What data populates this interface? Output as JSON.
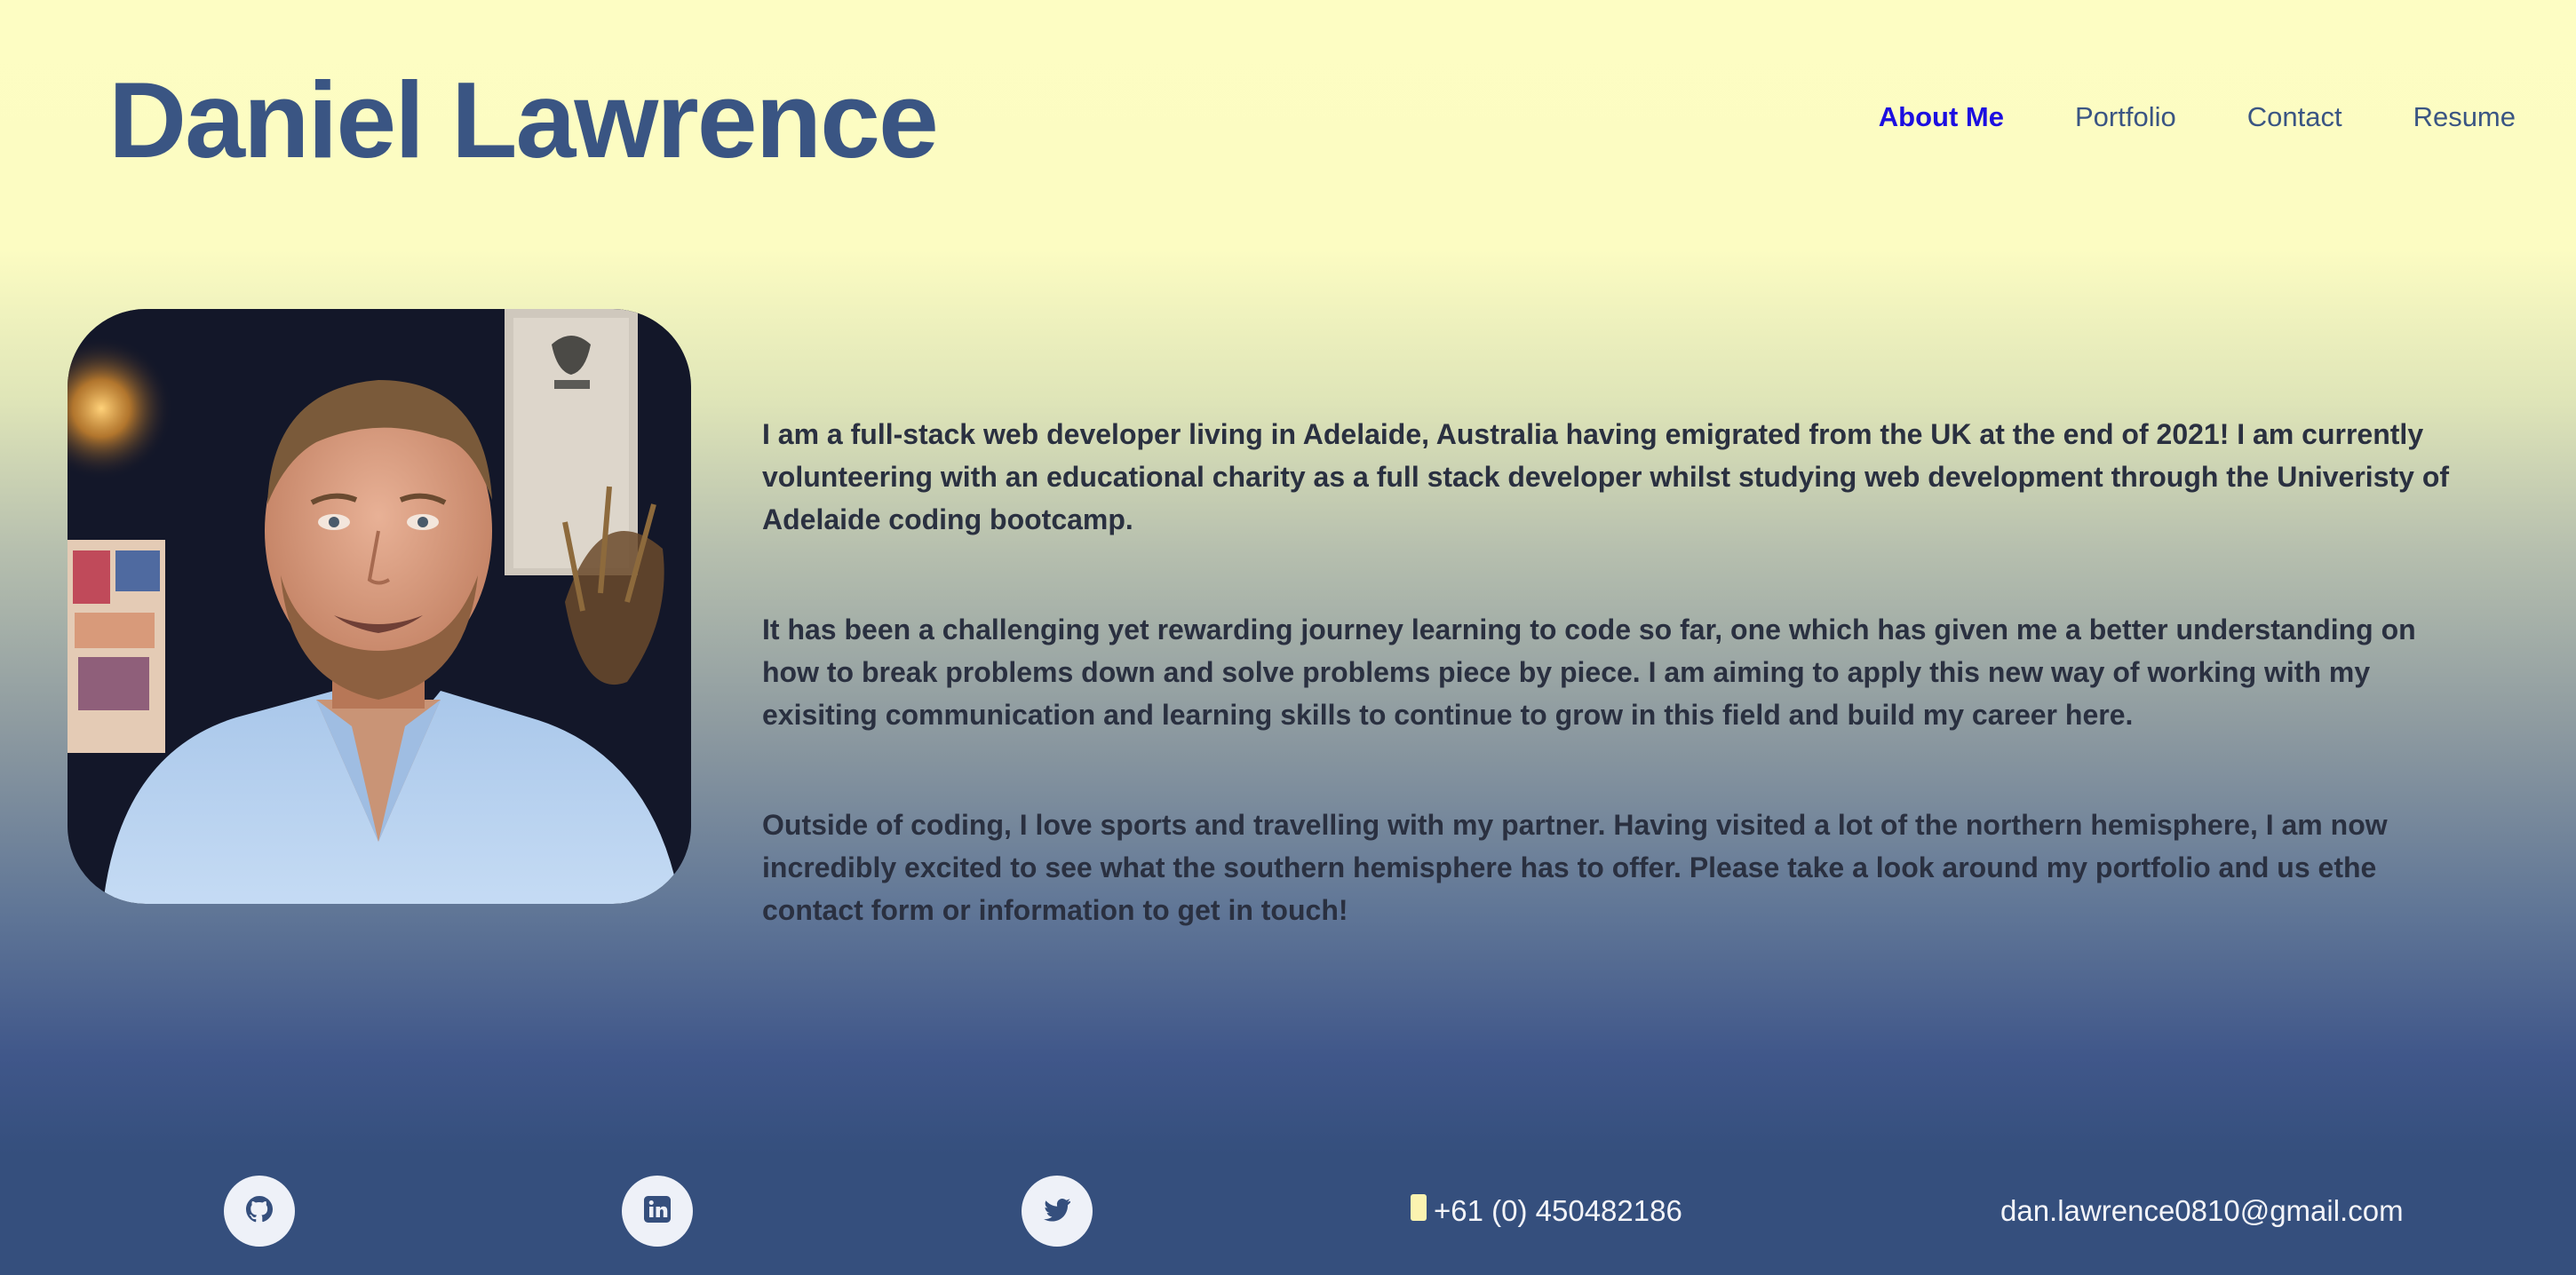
{
  "header": {
    "name": "Daniel Lawrence",
    "nav": [
      {
        "label": "About Me",
        "active": true
      },
      {
        "label": "Portfolio",
        "active": false
      },
      {
        "label": "Contact",
        "active": false
      },
      {
        "label": "Resume",
        "active": false
      }
    ]
  },
  "about": {
    "paragraphs": [
      "I am a full-stack web developer living in Adelaide, Australia having emigrated from the UK at the end of 2021! I am currently volunteering with an educational charity as a full stack developer whilst studying web development through the Univeristy of Adelaide coding bootcamp.",
      "It has been a challenging yet rewarding journey learning to code so far, one which has given me a better understanding on how to break problems down and solve problems piece by piece. I am aiming to apply this new way of working with my exisiting communication and learning skills to continue to grow in this field and build my career here.",
      "Outside of coding, I love sports and travelling with my partner. Having visited a lot of the northern hemisphere, I am now incredibly excited to see what the southern hemisphere has to offer. Please take a look around my portfolio and us ethe contact form or information to get in touch!"
    ]
  },
  "footer": {
    "social": [
      {
        "icon": "github-icon"
      },
      {
        "icon": "linkedin-icon"
      },
      {
        "icon": "twitter-icon"
      }
    ],
    "phone": "+61 (0) 450482186",
    "email": "dan.lawrence0810@gmail.com"
  },
  "colors": {
    "heading": "#3a5583",
    "nav_active": "#1c0ee0",
    "body_text": "#2a3040",
    "footer_bg": "#354f7d"
  }
}
